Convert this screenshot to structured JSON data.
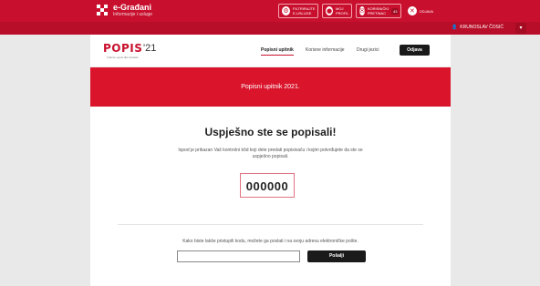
{
  "egradjani": {
    "title": "e-Građani",
    "subtitle": "Informacije i usluge"
  },
  "topbar_buttons": [
    {
      "label": "FILTRIRAJTE E-USLUGE",
      "icon": "filter-icon"
    },
    {
      "label": "MOJ PROFIL",
      "icon": "profile-icon"
    },
    {
      "label": "KORISNIČKI PRETINAC",
      "icon": "inbox-icon",
      "badge": "43"
    },
    {
      "label": "ODJAVA",
      "icon": "close-icon"
    }
  ],
  "user": {
    "name": "KRUNOSLAV ČOSIĆ"
  },
  "brand": {
    "logo": "POPIS",
    "year": "'21",
    "tagline": "Vodimo popis dla Hrvatski"
  },
  "nav": {
    "links": [
      "Popisni upitnik",
      "Korisne informacije",
      "Drugi jezici"
    ],
    "logout": "Odjava"
  },
  "hero": {
    "title": "Popisni upitnik 2021."
  },
  "main": {
    "heading": "Uspješno ste se popisali!",
    "description": "Ispod je prikazan Vaš kontrolni kôd koji dete predati popisivaču i kojim potvrđujete da ste se uspješno popisali.",
    "code": "000000"
  },
  "email": {
    "text": "Kako biste lakše pristupili kodu, možete ga poslati i na svoju adresu elektroničke pošte.",
    "input_value": "",
    "button": "Pošalji"
  },
  "colors": {
    "brand_red": "#c8102e",
    "hero_red": "#d9142b",
    "dark": "#1a1a1a"
  }
}
